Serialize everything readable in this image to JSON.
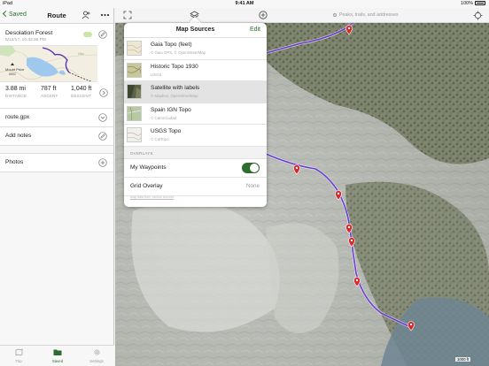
{
  "status": {
    "device": "iPad",
    "time": "9:41 AM",
    "battery": "100%"
  },
  "left": {
    "back_label": "Saved",
    "title": "Route",
    "track": {
      "name": "Desolation Forest",
      "date": "5/12/17, 10:43:46 PM",
      "map_label": "Mount Price\n8852",
      "distance_value": "3.88 mi",
      "distance_label": "DISTANCE",
      "ascent_value": "787 ft",
      "ascent_label": "ASCENT",
      "descent_value": "1,040 ft",
      "descent_label": "DESCENT"
    },
    "rows": [
      {
        "label": "route.gpx",
        "icon": "chevron-down-icon"
      },
      {
        "label": "Add notes",
        "icon": "pencil-icon"
      }
    ],
    "photos_label": "Photos",
    "tabs": [
      {
        "label": "Trip",
        "icon": "map-icon",
        "active": false
      },
      {
        "label": "Saved",
        "icon": "folder-icon",
        "active": true
      },
      {
        "label": "Settings",
        "icon": "gear-icon",
        "active": false
      }
    ]
  },
  "map": {
    "search_placeholder": "Peaks, trails, and addresses",
    "scale": "1000 ft"
  },
  "popover": {
    "title": "Map Sources",
    "edit_label": "Edit",
    "sources": [
      {
        "name": "Gaia Topo (feet)",
        "attribution": "© Gaia GPS, © OpenStreetMap",
        "selected": false,
        "color": "#efe7d6"
      },
      {
        "name": "Historic Topo 1930",
        "attribution": "USGS",
        "selected": false,
        "color": "#c7c79a"
      },
      {
        "name": "Satellite with labels",
        "attribution": "© Mapbox, OpenStreetMap",
        "selected": true,
        "color": "#5b6246"
      },
      {
        "name": "Spain IGN Topo",
        "attribution": "© CartoCiudad",
        "selected": false,
        "color": "#b7c9a3"
      },
      {
        "name": "USGS Topo",
        "attribution": "© CalTopo",
        "selected": false,
        "color": "#f1f1ec"
      }
    ],
    "overlays_header": "OVERLAYS",
    "waypoints_label": "My Waypoints",
    "waypoints_on": true,
    "grid_label": "Grid Overlay",
    "grid_value": "None",
    "footer_link": "Map data from various sources"
  },
  "colors": {
    "accent": "#2c6e2f",
    "route": "#6a3fd1",
    "marker": "#d7282b"
  }
}
